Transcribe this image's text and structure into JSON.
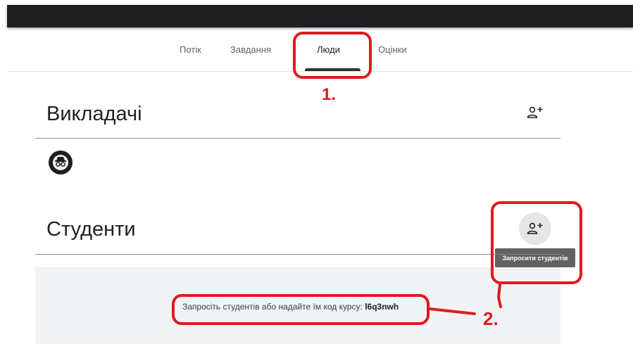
{
  "tabs": [
    {
      "label": "Потік"
    },
    {
      "label": "Завдання"
    },
    {
      "label": "Люди",
      "active": true
    },
    {
      "label": "Оцінки"
    }
  ],
  "teachers": {
    "title": "Викладачі",
    "add_icon": "person-add-icon",
    "avatar_icon": "incognito-avatar-icon"
  },
  "students": {
    "title": "Студенти",
    "add_icon": "person-add-icon",
    "tooltip": "Запросити студентів",
    "invite_text": "Запросіть студентів або надайте їм код курсу:",
    "course_code": "l6q3nwh"
  },
  "annotations": {
    "step1": "1.",
    "step2": "2.",
    "color": "#e01a1f"
  },
  "colors": {
    "topbar": "#1f1f21",
    "panel": "#f1f3f4",
    "tooltip": "#616161"
  }
}
